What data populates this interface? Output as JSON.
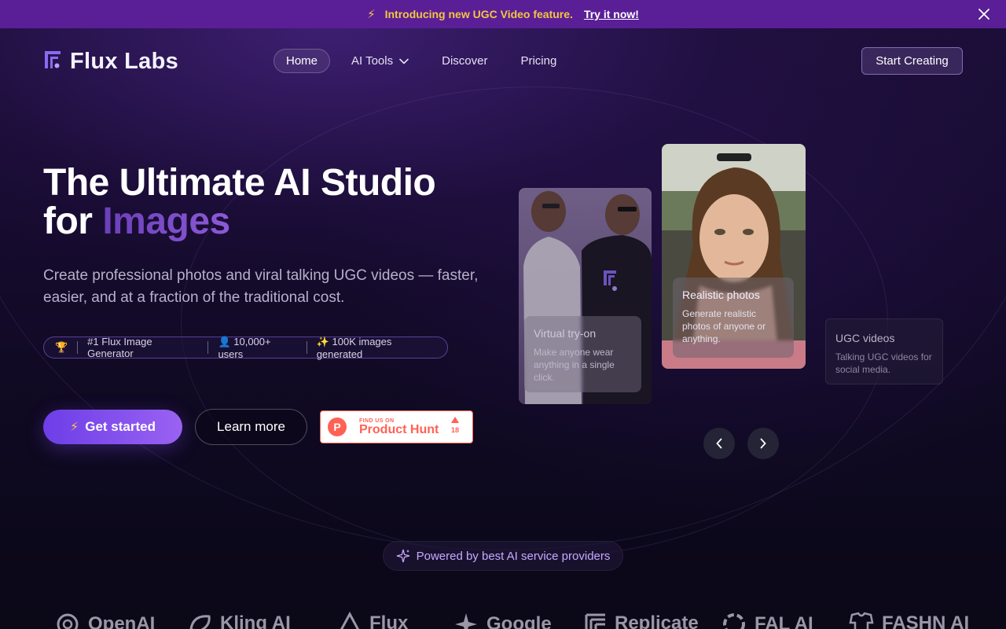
{
  "banner": {
    "text": "Introducing new UGC Video feature.",
    "link": "Try it now!"
  },
  "header": {
    "brand": "Flux Labs",
    "nav": [
      {
        "label": "Home",
        "active": true
      },
      {
        "label": "AI Tools",
        "has_dropdown": true
      },
      {
        "label": "Discover"
      },
      {
        "label": "Pricing"
      }
    ],
    "cta": "Start Creating"
  },
  "hero": {
    "title_line1": "The Ultimate AI Studio",
    "title_line2_prefix": "for ",
    "title_line2_accent": "Images",
    "subtitle": "Create professional photos and viral talking UGC videos — faster, easier, and at a fraction of the traditional cost.",
    "stats": {
      "trophy": "🏆",
      "generator": "#1 Flux Image Generator",
      "users": "👤 10,000+ users",
      "images": "✨ 100K images generated"
    },
    "primary_button": "Get started",
    "secondary_button": "Learn more",
    "product_hunt": {
      "eyebrow": "FIND US ON",
      "name": "Product Hunt",
      "votes": "18"
    }
  },
  "showcase": {
    "cards": [
      {
        "title": "Virtual try-on",
        "description": "Make anyone wear anything in a single click."
      },
      {
        "title": "Realistic photos",
        "description": "Generate realistic photos of anyone or anything."
      },
      {
        "title": "UGC videos",
        "description": "Talking UGC videos for social media."
      }
    ]
  },
  "powered_by": "Powered by best AI service providers",
  "providers": [
    "OpenAI",
    "Kling AI",
    "Flux",
    "Google",
    "Replicate",
    "FAL AI",
    "FASHN AI"
  ],
  "colors": {
    "banner": "#5a1f96",
    "accent": "#7c4ef0",
    "banner_text": "#f5c542",
    "product_hunt": "#ff6154"
  }
}
